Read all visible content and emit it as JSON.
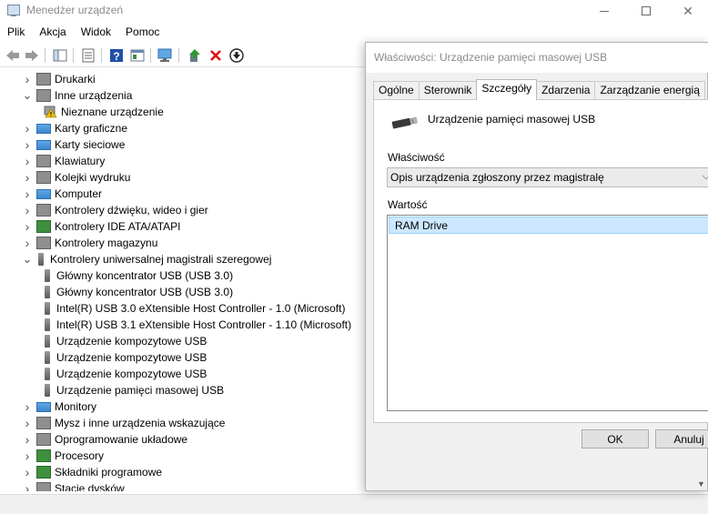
{
  "window": {
    "title": "Menedżer urządzeń"
  },
  "menu": [
    "Plik",
    "Akcja",
    "Widok",
    "Pomoc"
  ],
  "tree": [
    {
      "label": "Drukarki",
      "expanded": false,
      "level": 0,
      "icon": "printer-icon"
    },
    {
      "label": "Inne urządzenia",
      "expanded": true,
      "level": 0,
      "icon": "unknown-device-icon"
    },
    {
      "label": "Nieznane urządzenie",
      "level": 1,
      "icon": "warning-device-icon"
    },
    {
      "label": "Karty graficzne",
      "expanded": false,
      "level": 0,
      "icon": "display-adapter-icon"
    },
    {
      "label": "Karty sieciowe",
      "expanded": false,
      "level": 0,
      "icon": "network-adapter-icon"
    },
    {
      "label": "Klawiatury",
      "expanded": false,
      "level": 0,
      "icon": "keyboard-icon"
    },
    {
      "label": "Kolejki wydruku",
      "expanded": false,
      "level": 0,
      "icon": "print-queue-icon"
    },
    {
      "label": "Komputer",
      "expanded": false,
      "level": 0,
      "icon": "computer-icon"
    },
    {
      "label": "Kontrolery dźwięku, wideo i gier",
      "expanded": false,
      "level": 0,
      "icon": "speaker-icon"
    },
    {
      "label": "Kontrolery IDE ATA/ATAPI",
      "expanded": false,
      "level": 0,
      "icon": "ide-controller-icon"
    },
    {
      "label": "Kontrolery magazynu",
      "expanded": false,
      "level": 0,
      "icon": "storage-controller-icon"
    },
    {
      "label": "Kontrolery uniwersalnej magistrali szeregowej",
      "expanded": true,
      "level": 0,
      "icon": "usb-icon"
    },
    {
      "label": "Główny koncentrator USB (USB 3.0)",
      "level": 1,
      "icon": "usb-icon"
    },
    {
      "label": "Główny koncentrator USB (USB 3.0)",
      "level": 1,
      "icon": "usb-icon"
    },
    {
      "label": "Intel(R) USB 3.0 eXtensible Host Controller - 1.0 (Microsoft)",
      "level": 1,
      "icon": "usb-icon"
    },
    {
      "label": "Intel(R) USB 3.1 eXtensible Host Controller - 1.10 (Microsoft)",
      "level": 1,
      "icon": "usb-icon"
    },
    {
      "label": "Urządzenie kompozytowe USB",
      "level": 1,
      "icon": "usb-icon"
    },
    {
      "label": "Urządzenie kompozytowe USB",
      "level": 1,
      "icon": "usb-icon"
    },
    {
      "label": "Urządzenie kompozytowe USB",
      "level": 1,
      "icon": "usb-icon"
    },
    {
      "label": "Urządzenie pamięci masowej USB",
      "level": 1,
      "icon": "usb-icon"
    },
    {
      "label": "Monitory",
      "expanded": false,
      "level": 0,
      "icon": "monitor-icon"
    },
    {
      "label": "Mysz i inne urządzenia wskazujące",
      "expanded": false,
      "level": 0,
      "icon": "mouse-icon"
    },
    {
      "label": "Oprogramowanie układowe",
      "expanded": false,
      "level": 0,
      "icon": "firmware-icon"
    },
    {
      "label": "Procesory",
      "expanded": false,
      "level": 0,
      "icon": "processor-icon"
    },
    {
      "label": "Składniki programowe",
      "expanded": false,
      "level": 0,
      "icon": "software-component-icon"
    },
    {
      "label": "Stacje dysków",
      "expanded": false,
      "level": 0,
      "icon": "disk-drive-icon"
    }
  ],
  "dialog": {
    "title": "Właściwości: Urządzenie pamięci masowej USB",
    "tabs": [
      "Ogólne",
      "Sterownik",
      "Szczegóły",
      "Zdarzenia",
      "Zarządzanie energią"
    ],
    "active_tab": "Szczegóły",
    "device_name": "Urządzenie pamięci masowej USB",
    "property_label": "Właściwość",
    "property_value": "Opis urządzenia zgłoszony przez magistralę",
    "value_label": "Wartość",
    "value_items": [
      "RAM Drive"
    ],
    "ok_label": "OK",
    "cancel_label": "Anuluj"
  }
}
